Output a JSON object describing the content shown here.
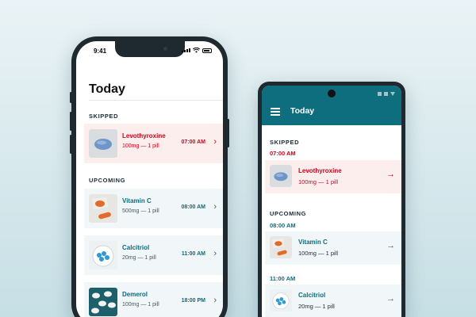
{
  "ios": {
    "status_time": "9:41",
    "title": "Today",
    "skipped_label": "SKIPPED",
    "upcoming_label": "UPCOMING",
    "skipped": [
      {
        "name": "Levothyroxine",
        "dose": "100mg — 1 pill",
        "time": "07:00 AM",
        "icon": "blue-oval-pill-photo"
      }
    ],
    "upcoming": [
      {
        "name": "Vitamin C",
        "dose": "500mg — 1 pill",
        "time": "08:00 AM",
        "icon": "orange-capsule-photo"
      },
      {
        "name": "Calcitriol",
        "dose": "20mg — 1 pill",
        "time": "11:00 AM",
        "icon": "blue-pills-jar-photo"
      },
      {
        "name": "Demerol",
        "dose": "100mg — 1 pill",
        "time": "18:00 PM",
        "icon": "white-pills-photo"
      }
    ]
  },
  "android": {
    "title": "Today",
    "skipped_label": "SKIPPED",
    "upcoming_label": "UPCOMING",
    "skipped": [
      {
        "time": "07:00 AM",
        "name": "Levothyroxine",
        "dose": "100mg — 1 pill",
        "icon": "blue-oval-pill-photo"
      }
    ],
    "upcoming": [
      {
        "time": "08:00 AM",
        "name": "Vitamin C",
        "dose": "100mg — 1 pill",
        "icon": "orange-capsule-photo"
      },
      {
        "time": "11:00 AM",
        "name": "Calcitriol",
        "dose": "20mg — 1 pill",
        "icon": "blue-pills-jar-photo"
      }
    ]
  },
  "colors": {
    "accent": "#0e6e7e",
    "skipped_red": "#d0021b",
    "skipped_bg": "#fdeeee",
    "row_bg": "#f1f6f8"
  }
}
